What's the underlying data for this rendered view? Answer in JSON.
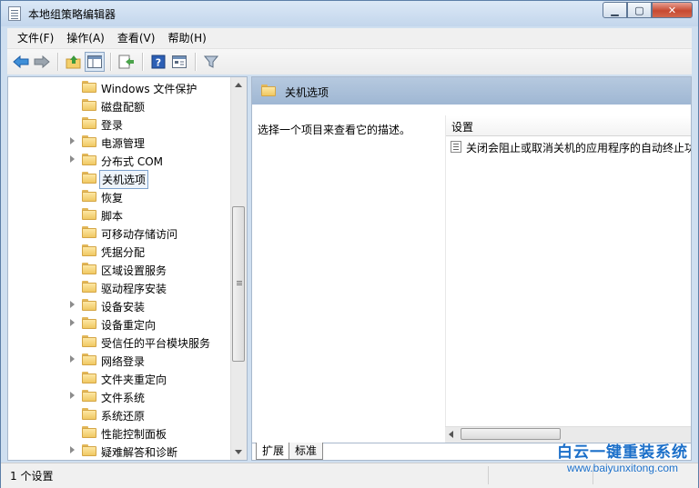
{
  "window": {
    "title": "本地组策略编辑器"
  },
  "menu": [
    "文件(F)",
    "操作(A)",
    "查看(V)",
    "帮助(H)"
  ],
  "toolbar": [
    "back-icon",
    "forward-icon",
    "up-folder-icon",
    "show-hide-tree-icon",
    "export-list-icon",
    "help-icon",
    "properties-icon",
    "filter-icon"
  ],
  "tree": {
    "items": [
      {
        "label": "Windows 文件保护",
        "expandable": false
      },
      {
        "label": "磁盘配额",
        "expandable": false
      },
      {
        "label": "登录",
        "expandable": false
      },
      {
        "label": "电源管理",
        "expandable": true
      },
      {
        "label": "分布式 COM",
        "expandable": true
      },
      {
        "label": "关机选项",
        "expandable": false,
        "selected": true
      },
      {
        "label": "恢复",
        "expandable": false
      },
      {
        "label": "脚本",
        "expandable": false
      },
      {
        "label": "可移动存储访问",
        "expandable": false
      },
      {
        "label": "凭据分配",
        "expandable": false
      },
      {
        "label": "区域设置服务",
        "expandable": false
      },
      {
        "label": "驱动程序安装",
        "expandable": false
      },
      {
        "label": "设备安装",
        "expandable": true
      },
      {
        "label": "设备重定向",
        "expandable": true
      },
      {
        "label": "受信任的平台模块服务",
        "expandable": false
      },
      {
        "label": "网络登录",
        "expandable": true
      },
      {
        "label": "文件夹重定向",
        "expandable": false
      },
      {
        "label": "文件系统",
        "expandable": true
      },
      {
        "label": "系统还原",
        "expandable": false
      },
      {
        "label": "性能控制面板",
        "expandable": false
      },
      {
        "label": "疑难解答和诊断",
        "expandable": true
      }
    ]
  },
  "details": {
    "header_title": "关机选项",
    "description": "选择一个项目来查看它的描述。",
    "column_header": "设置",
    "settings": [
      "关闭会阻止或取消关机的应用程序的自动终止功能"
    ]
  },
  "tabs": [
    "扩展",
    "标准"
  ],
  "status": {
    "text": "1 个设置"
  },
  "watermark": {
    "title": "白云一键重装系统",
    "url": "www.baiyunxitong.com"
  }
}
